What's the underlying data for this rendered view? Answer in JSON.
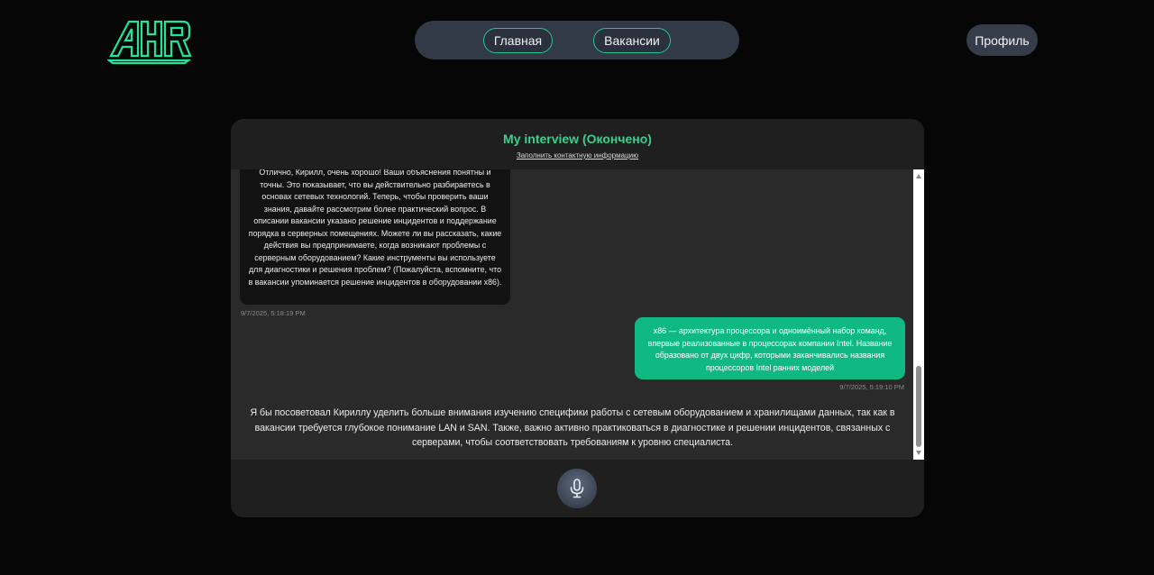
{
  "header": {
    "logo_text": "AHR",
    "nav": {
      "home_label": "Главная",
      "vacancies_label": "Вакансии"
    },
    "profile_label": "Профиль"
  },
  "interview": {
    "title": "My interview (Окончено)",
    "contact_link": "Заполнить контактную информацию",
    "messages": [
      {
        "role": "bot",
        "text": "Отлично, Кирилл, очень хорошо! Ваши объяснения понятны и точны. Это показывает, что вы действительно разбираетесь в основах сетевых технологий. Теперь, чтобы проверить ваши знания, давайте рассмотрим более практический вопрос. В описании вакансии указано решение инцидентов и поддержание порядка в серверных помещениях. Можете ли вы рассказать, какие действия вы предпринимаете, когда возникают проблемы с серверным оборудованием? Какие инструменты вы используете для диагностики и решения проблем? (Пожалуйста, вспомните, что в вакансии упоминается решение инцидентов в оборудовании x86).",
        "timestamp": "9/7/2025, 5:18:19 PM"
      },
      {
        "role": "user",
        "text": "x86 — архитектура процессора и одноимённый набор команд, впервые реализованные в процессорах компании Intel. Название образовано от двух цифр, которыми заканчивались названия процессоров Intel ранних моделей",
        "timestamp": "9/7/2025, 5:19:10 PM"
      }
    ],
    "summary": "Я бы посоветовал Кириллу уделить больше внимания изучению специфики работы с сетевым оборудованием и хранилищами данных, так как в вакансии требуется глубокое понимание LAN и SAN. Также, важно активно практиковаться в диагностике и решении инцидентов, связанных с серверами, чтобы соответствовать требованиям к уровню специалиста.",
    "mic_icon": "microphone-icon"
  },
  "colors": {
    "accent": "#3bd08a",
    "user_bubble": "#10b981",
    "bot_bubble": "#121212",
    "background": "#060606"
  }
}
